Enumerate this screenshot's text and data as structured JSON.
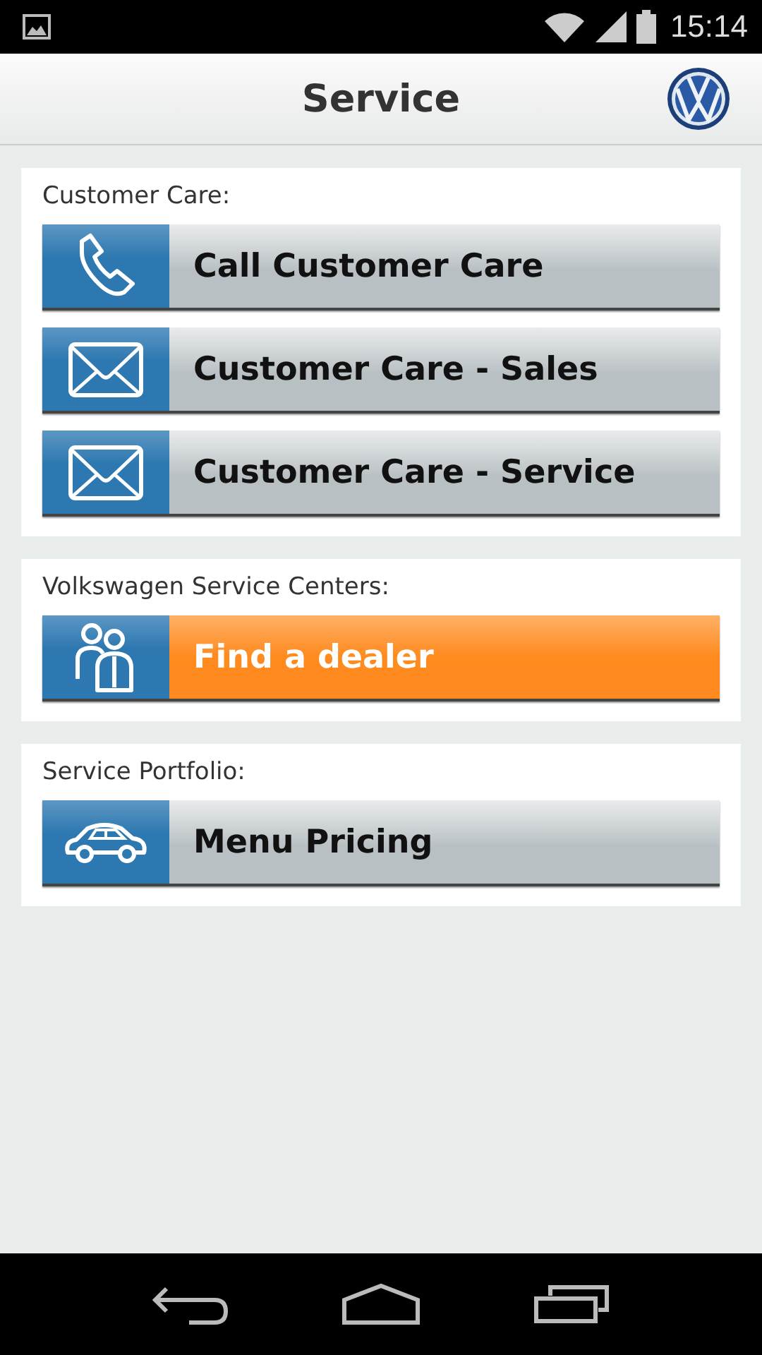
{
  "status_bar": {
    "time": "15:14"
  },
  "header": {
    "title": "Service"
  },
  "sections": [
    {
      "label": "Customer Care:",
      "buttons": [
        {
          "kind": "phone",
          "label": "Call Customer Care",
          "highlighted": false
        },
        {
          "kind": "mail",
          "label": "Customer Care - Sales",
          "highlighted": false
        },
        {
          "kind": "mail",
          "label": "Customer Care - Service",
          "highlighted": false
        }
      ]
    },
    {
      "label": "Volkswagen Service Centers:",
      "buttons": [
        {
          "kind": "people",
          "label": "Find a dealer",
          "highlighted": true
        }
      ]
    },
    {
      "label": "Service Portfolio:",
      "buttons": [
        {
          "kind": "car",
          "label": "Menu Pricing",
          "highlighted": false
        }
      ]
    }
  ]
}
